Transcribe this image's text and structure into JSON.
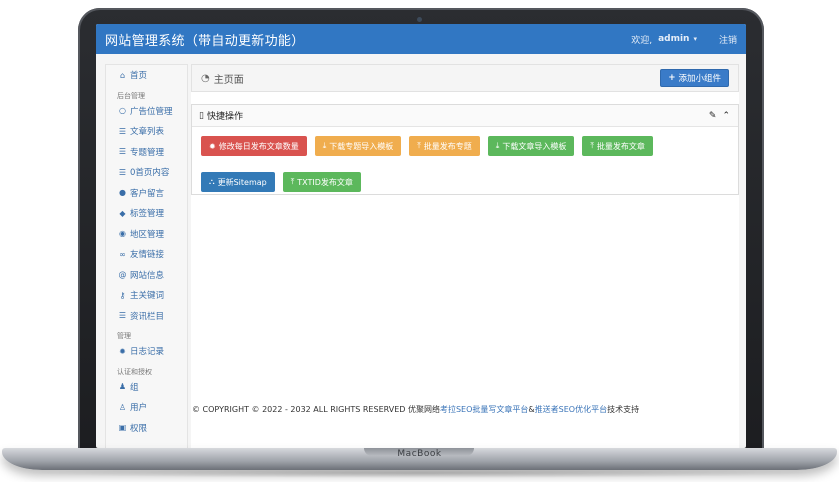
{
  "device": {
    "brand": "MacBook"
  },
  "navbar": {
    "title": "网站管理系统（带自动更新功能）",
    "welcome": "欢迎,",
    "user": "admin",
    "logout": "注销"
  },
  "sidebar": {
    "items": [
      {
        "type": "item",
        "icon": "home-icon",
        "glyph": "⌂",
        "label": "首页"
      },
      {
        "type": "header",
        "label": "后台管理"
      },
      {
        "type": "item",
        "icon": "circle-icon",
        "glyph": "○",
        "label": "广告位管理"
      },
      {
        "type": "item",
        "icon": "list-icon",
        "glyph": "☰",
        "label": "文章列表"
      },
      {
        "type": "item",
        "icon": "list-icon",
        "glyph": "☰",
        "label": "专题管理"
      },
      {
        "type": "item",
        "icon": "list-icon",
        "glyph": "☰",
        "label": "0首页内容"
      },
      {
        "type": "item",
        "icon": "comment-icon",
        "glyph": "●",
        "label": "客户留言"
      },
      {
        "type": "item",
        "icon": "tags-icon",
        "glyph": "◆",
        "label": "标签管理"
      },
      {
        "type": "item",
        "icon": "map-marker-icon",
        "glyph": "◉",
        "label": "地区管理"
      },
      {
        "type": "item",
        "icon": "link-icon",
        "glyph": "∞",
        "label": "友情链接"
      },
      {
        "type": "item",
        "icon": "at-icon",
        "glyph": "@",
        "label": "网站信息"
      },
      {
        "type": "item",
        "icon": "key-icon",
        "glyph": "⚷",
        "label": "主关键词"
      },
      {
        "type": "item",
        "icon": "list-icon",
        "glyph": "☰",
        "label": "资讯栏目"
      },
      {
        "type": "header",
        "label": "管理"
      },
      {
        "type": "item",
        "icon": "gear-icon",
        "glyph": "✹",
        "label": "日志记录"
      },
      {
        "type": "header",
        "label": "认证和授权"
      },
      {
        "type": "item",
        "icon": "users-icon",
        "glyph": "♟",
        "label": "组"
      },
      {
        "type": "item",
        "icon": "user-icon",
        "glyph": "♙",
        "label": "用户"
      },
      {
        "type": "item",
        "icon": "lock-icon",
        "glyph": "▣",
        "label": "权限"
      }
    ]
  },
  "page": {
    "title": "主页面",
    "add_widget": "添加小组件"
  },
  "quick_panel": {
    "title": "快捷操作",
    "buttons": [
      {
        "label": "修改每日发布文章数量",
        "color": "#d9534f",
        "icon": "gear-icon",
        "glyph": "✹"
      },
      {
        "label": "下载专题导入模板",
        "color": "#f0ad4e",
        "icon": "download-icon",
        "glyph": "⤓"
      },
      {
        "label": "批量发布专题",
        "color": "#f0ad4e",
        "icon": "upload-icon",
        "glyph": "⤒"
      },
      {
        "label": "下载文章导入模板",
        "color": "#5cb85c",
        "icon": "download-icon",
        "glyph": "⤓"
      },
      {
        "label": "批量发布文章",
        "color": "#5cb85c",
        "icon": "upload-icon",
        "glyph": "⤒"
      },
      {
        "label": "更新Sitemap",
        "color": "#337ab7",
        "icon": "sitemap-icon",
        "glyph": "⛬"
      },
      {
        "label": "TXTID发布文章",
        "color": "#5cb85c",
        "icon": "upload-icon",
        "glyph": "⤒"
      }
    ]
  },
  "footer": {
    "text1": "© COPYRIGHT © 2022 - 2032 ALL RIGHTS RESERVED 优聚网络",
    "link1": "考拉SEO批量写文章平台",
    "amp": "&",
    "link2": "推送者SEO优化平台",
    "text2": "技术支持"
  }
}
